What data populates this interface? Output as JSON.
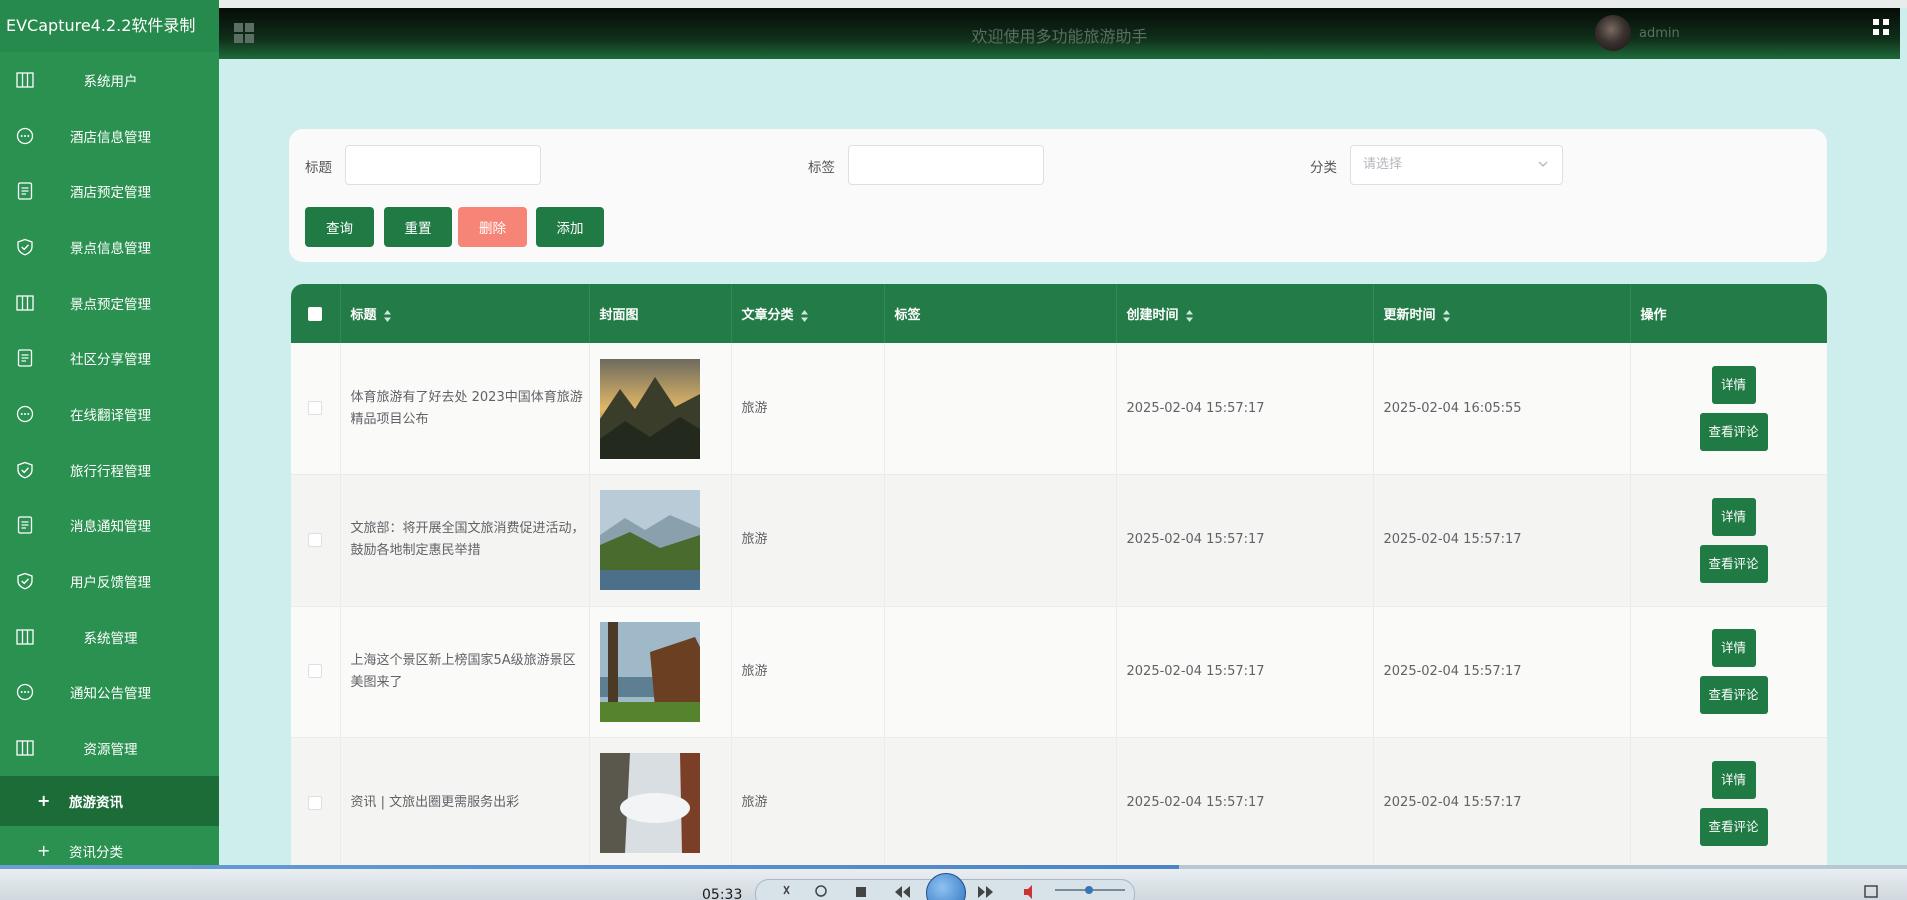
{
  "app": {
    "title": "EVCapture4.2.2软件录制"
  },
  "header": {
    "title": "欢迎使用多功能旅游助手",
    "username": "admin"
  },
  "sidebar": {
    "items": [
      {
        "label": "系统用户",
        "icon": "table-icon"
      },
      {
        "label": "酒店信息管理",
        "icon": "chat-icon"
      },
      {
        "label": "酒店预定管理",
        "icon": "document-icon"
      },
      {
        "label": "景点信息管理",
        "icon": "shield-icon"
      },
      {
        "label": "景点预定管理",
        "icon": "table-icon"
      },
      {
        "label": "社区分享管理",
        "icon": "document-icon"
      },
      {
        "label": "在线翻译管理",
        "icon": "chat-icon"
      },
      {
        "label": "旅行行程管理",
        "icon": "shield-icon"
      },
      {
        "label": "消息通知管理",
        "icon": "document-icon"
      },
      {
        "label": "用户反馈管理",
        "icon": "shield-icon"
      },
      {
        "label": "系统管理",
        "icon": "table-icon"
      },
      {
        "label": "通知公告管理",
        "icon": "chat-icon"
      },
      {
        "label": "资源管理",
        "icon": "table-icon"
      }
    ],
    "sub_items": [
      {
        "label": "旅游资讯",
        "active": true
      },
      {
        "label": "资讯分类",
        "active": false
      }
    ]
  },
  "search": {
    "title_label": "标题",
    "tag_label": "标签",
    "category_label": "分类",
    "category_placeholder": "请选择",
    "buttons": {
      "query": "查询",
      "reset": "重置",
      "delete": "删除",
      "add": "添加"
    }
  },
  "table": {
    "columns": [
      "标题",
      "封面图",
      "文章分类",
      "标签",
      "创建时间",
      "更新时间",
      "操作"
    ],
    "rows": [
      {
        "title": "体育旅游有了好去处 2023中国体育旅游精品项目公布",
        "category": "旅游",
        "tag": "",
        "created": "2025-02-04 15:57:17",
        "updated": "2025-02-04 16:05:55"
      },
      {
        "title": "文旅部：将开展全国文旅消费促进活动，鼓励各地制定惠民举措",
        "category": "旅游",
        "tag": "",
        "created": "2025-02-04 15:57:17",
        "updated": "2025-02-04 15:57:17"
      },
      {
        "title": "上海这个景区新上榜国家5A级旅游景区 美图来了",
        "category": "旅游",
        "tag": "",
        "created": "2025-02-04 15:57:17",
        "updated": "2025-02-04 15:57:17"
      },
      {
        "title": "资讯 | 文旅出圈更需服务出彩",
        "category": "旅游",
        "tag": "",
        "created": "2025-02-04 15:57:17",
        "updated": "2025-02-04 15:57:17"
      }
    ],
    "actions": {
      "detail": "详情",
      "comments": "查看评论"
    }
  },
  "player": {
    "time": "05:33",
    "progress": 0.618
  },
  "colors": {
    "sidebar": "#2a9150",
    "header_dark": "#0f2e19",
    "primary": "#1f7a43",
    "danger": "#f78577",
    "page_bg": "#cdeeed"
  }
}
